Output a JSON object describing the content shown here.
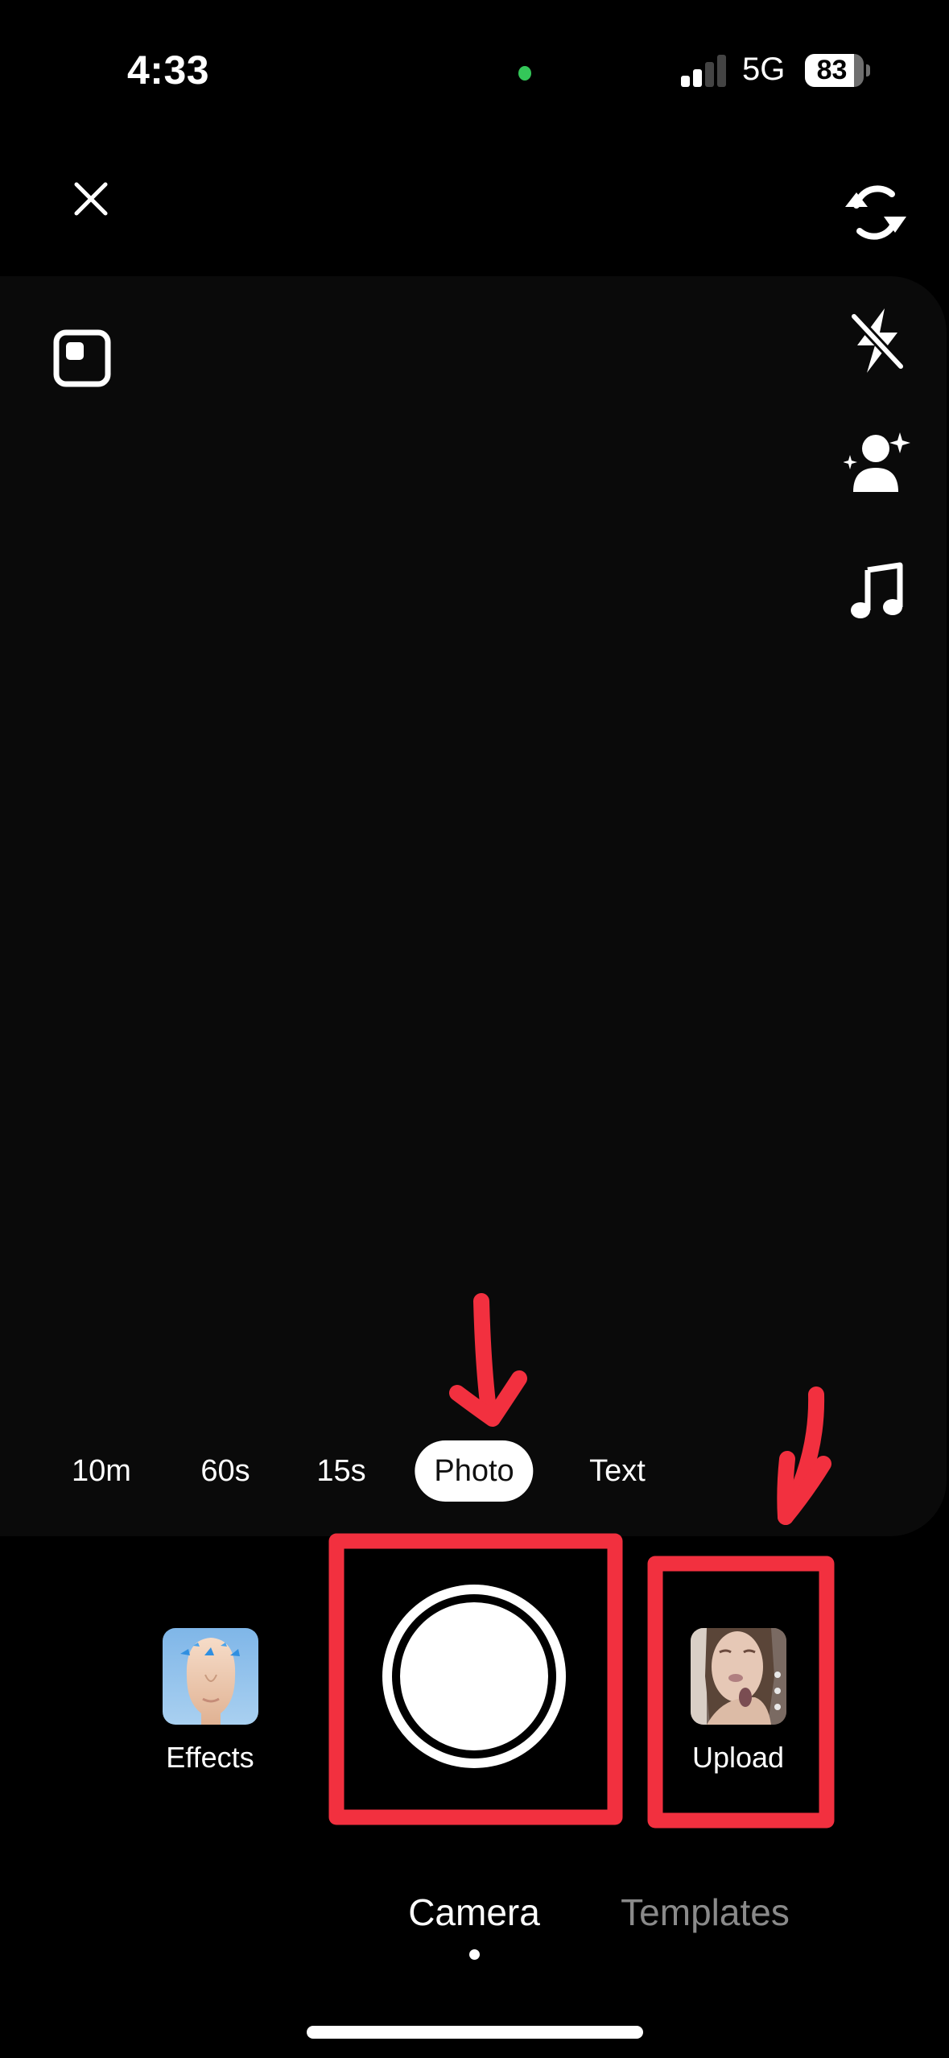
{
  "status_bar": {
    "time": "4:33",
    "network": "5G",
    "signal_bars_active": 2,
    "signal_bars_total": 4,
    "battery_percent": 83,
    "recording_indicator_color": "#34c759"
  },
  "top_controls": {
    "close_icon": "close-icon",
    "flip_icon": "flip-camera-icon",
    "ratio_icon": "aspect-ratio-icon"
  },
  "side_tools": [
    {
      "icon": "flash-off-icon"
    },
    {
      "icon": "beauty-person-sparkle-icon"
    },
    {
      "icon": "music-note-icon"
    }
  ],
  "modes": {
    "items": [
      {
        "label": "10m"
      },
      {
        "label": "60s"
      },
      {
        "label": "15s"
      },
      {
        "label": "Photo",
        "active": true
      },
      {
        "label": "Text"
      }
    ],
    "selected": "Photo"
  },
  "capture": {
    "effects_label": "Effects",
    "upload_label": "Upload",
    "shutter_icon": "shutter-button"
  },
  "bottom_tabs": {
    "items": [
      {
        "label": "Camera",
        "active": true
      },
      {
        "label": "Templates",
        "active": false
      }
    ]
  },
  "annotations": {
    "color": "#f2303f",
    "highlights": [
      "shutter-button",
      "upload-button"
    ],
    "arrows": [
      "arrow-to-photo-mode",
      "arrow-to-upload"
    ]
  },
  "colors": {
    "background": "#000000",
    "viewfinder": "#0a0a0a",
    "inactive_tab": "#8a8a8a",
    "text": "#ffffff"
  }
}
